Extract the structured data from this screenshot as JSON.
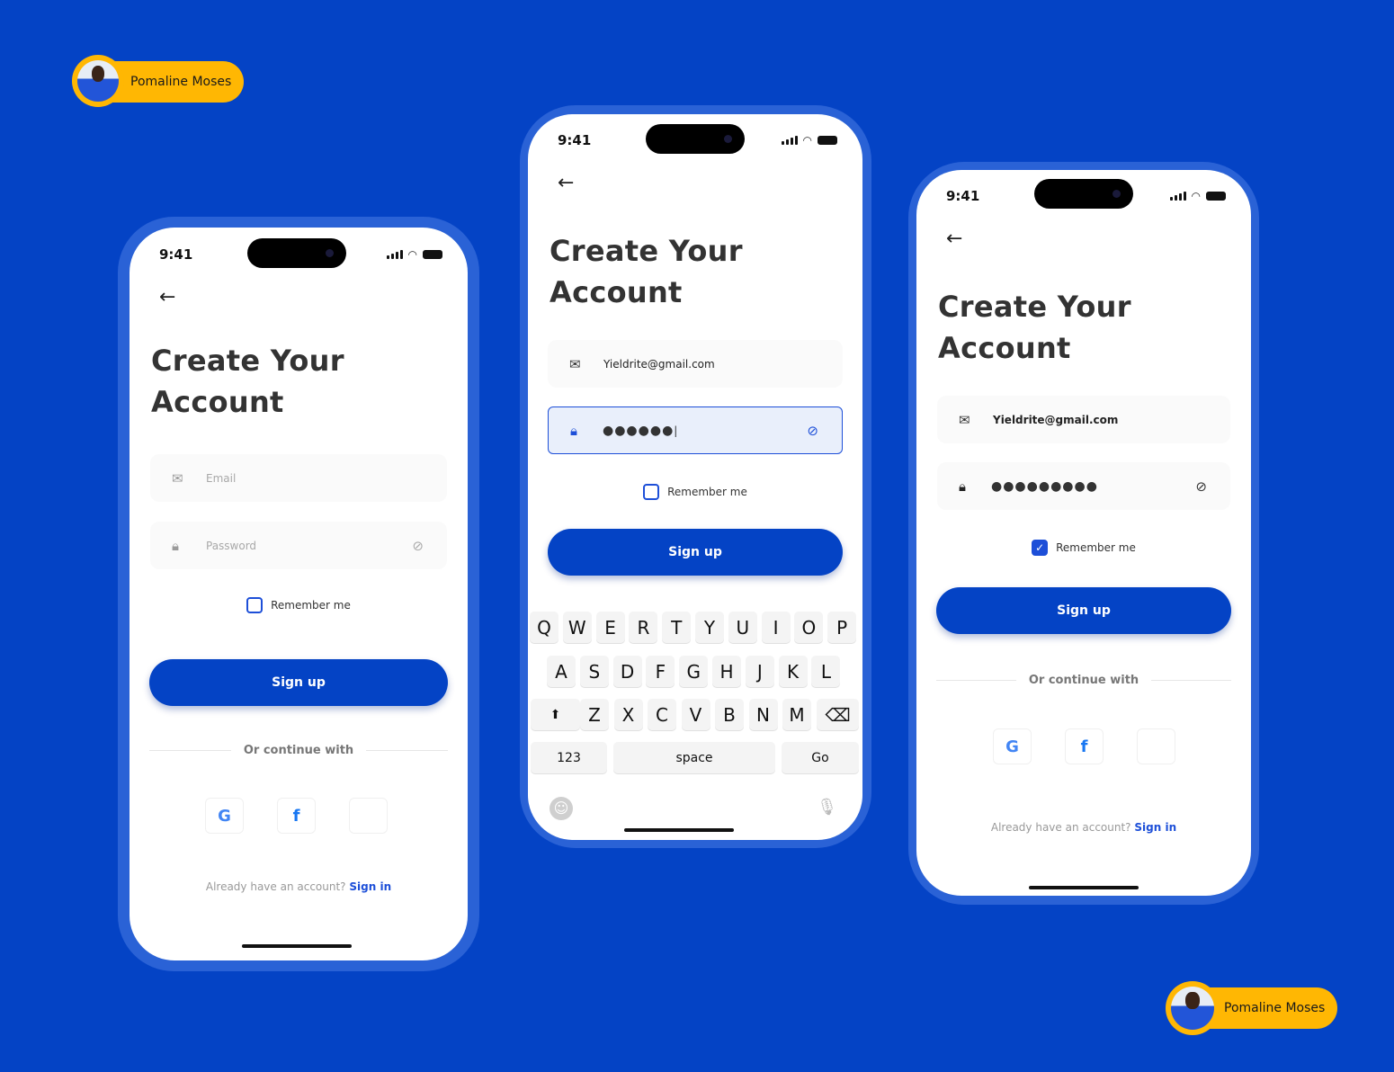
{
  "colors": {
    "background": "#0443C5",
    "accent": "#1D4FD8",
    "badge": "#FFB703"
  },
  "badges": [
    {
      "name": "Pomaline Moses"
    },
    {
      "name": "Pomaline Moses"
    }
  ],
  "status": {
    "time": "9:41"
  },
  "screen": {
    "title_line1": "Create Your",
    "title_line2": "Account",
    "email_placeholder": "Email",
    "password_placeholder": "Password",
    "email_value": "Yieldrite@gmail.com",
    "password_dots_typing": "●●●●●●",
    "password_dots_full": "●●●●●●●●●",
    "remember": "Remember me",
    "signup": "Sign up",
    "or_continue": "Or continue with",
    "already": "Already have an account?",
    "signin": "Sign in",
    "social": [
      "google-icon",
      "facebook-icon",
      "apple-icon"
    ]
  },
  "phones": [
    {
      "state": "empty",
      "remember_checked": false
    },
    {
      "state": "typing-password",
      "remember_checked": false
    },
    {
      "state": "filled",
      "remember_checked": true
    }
  ],
  "keyboard": {
    "row1": [
      "Q",
      "W",
      "E",
      "R",
      "T",
      "Y",
      "U",
      "I",
      "O",
      "P"
    ],
    "row2": [
      "A",
      "S",
      "D",
      "F",
      "G",
      "H",
      "J",
      "K",
      "L"
    ],
    "row3": [
      "Z",
      "X",
      "C",
      "V",
      "B",
      "N",
      "M"
    ],
    "numbers": "123",
    "space": "space",
    "go": "Go"
  }
}
